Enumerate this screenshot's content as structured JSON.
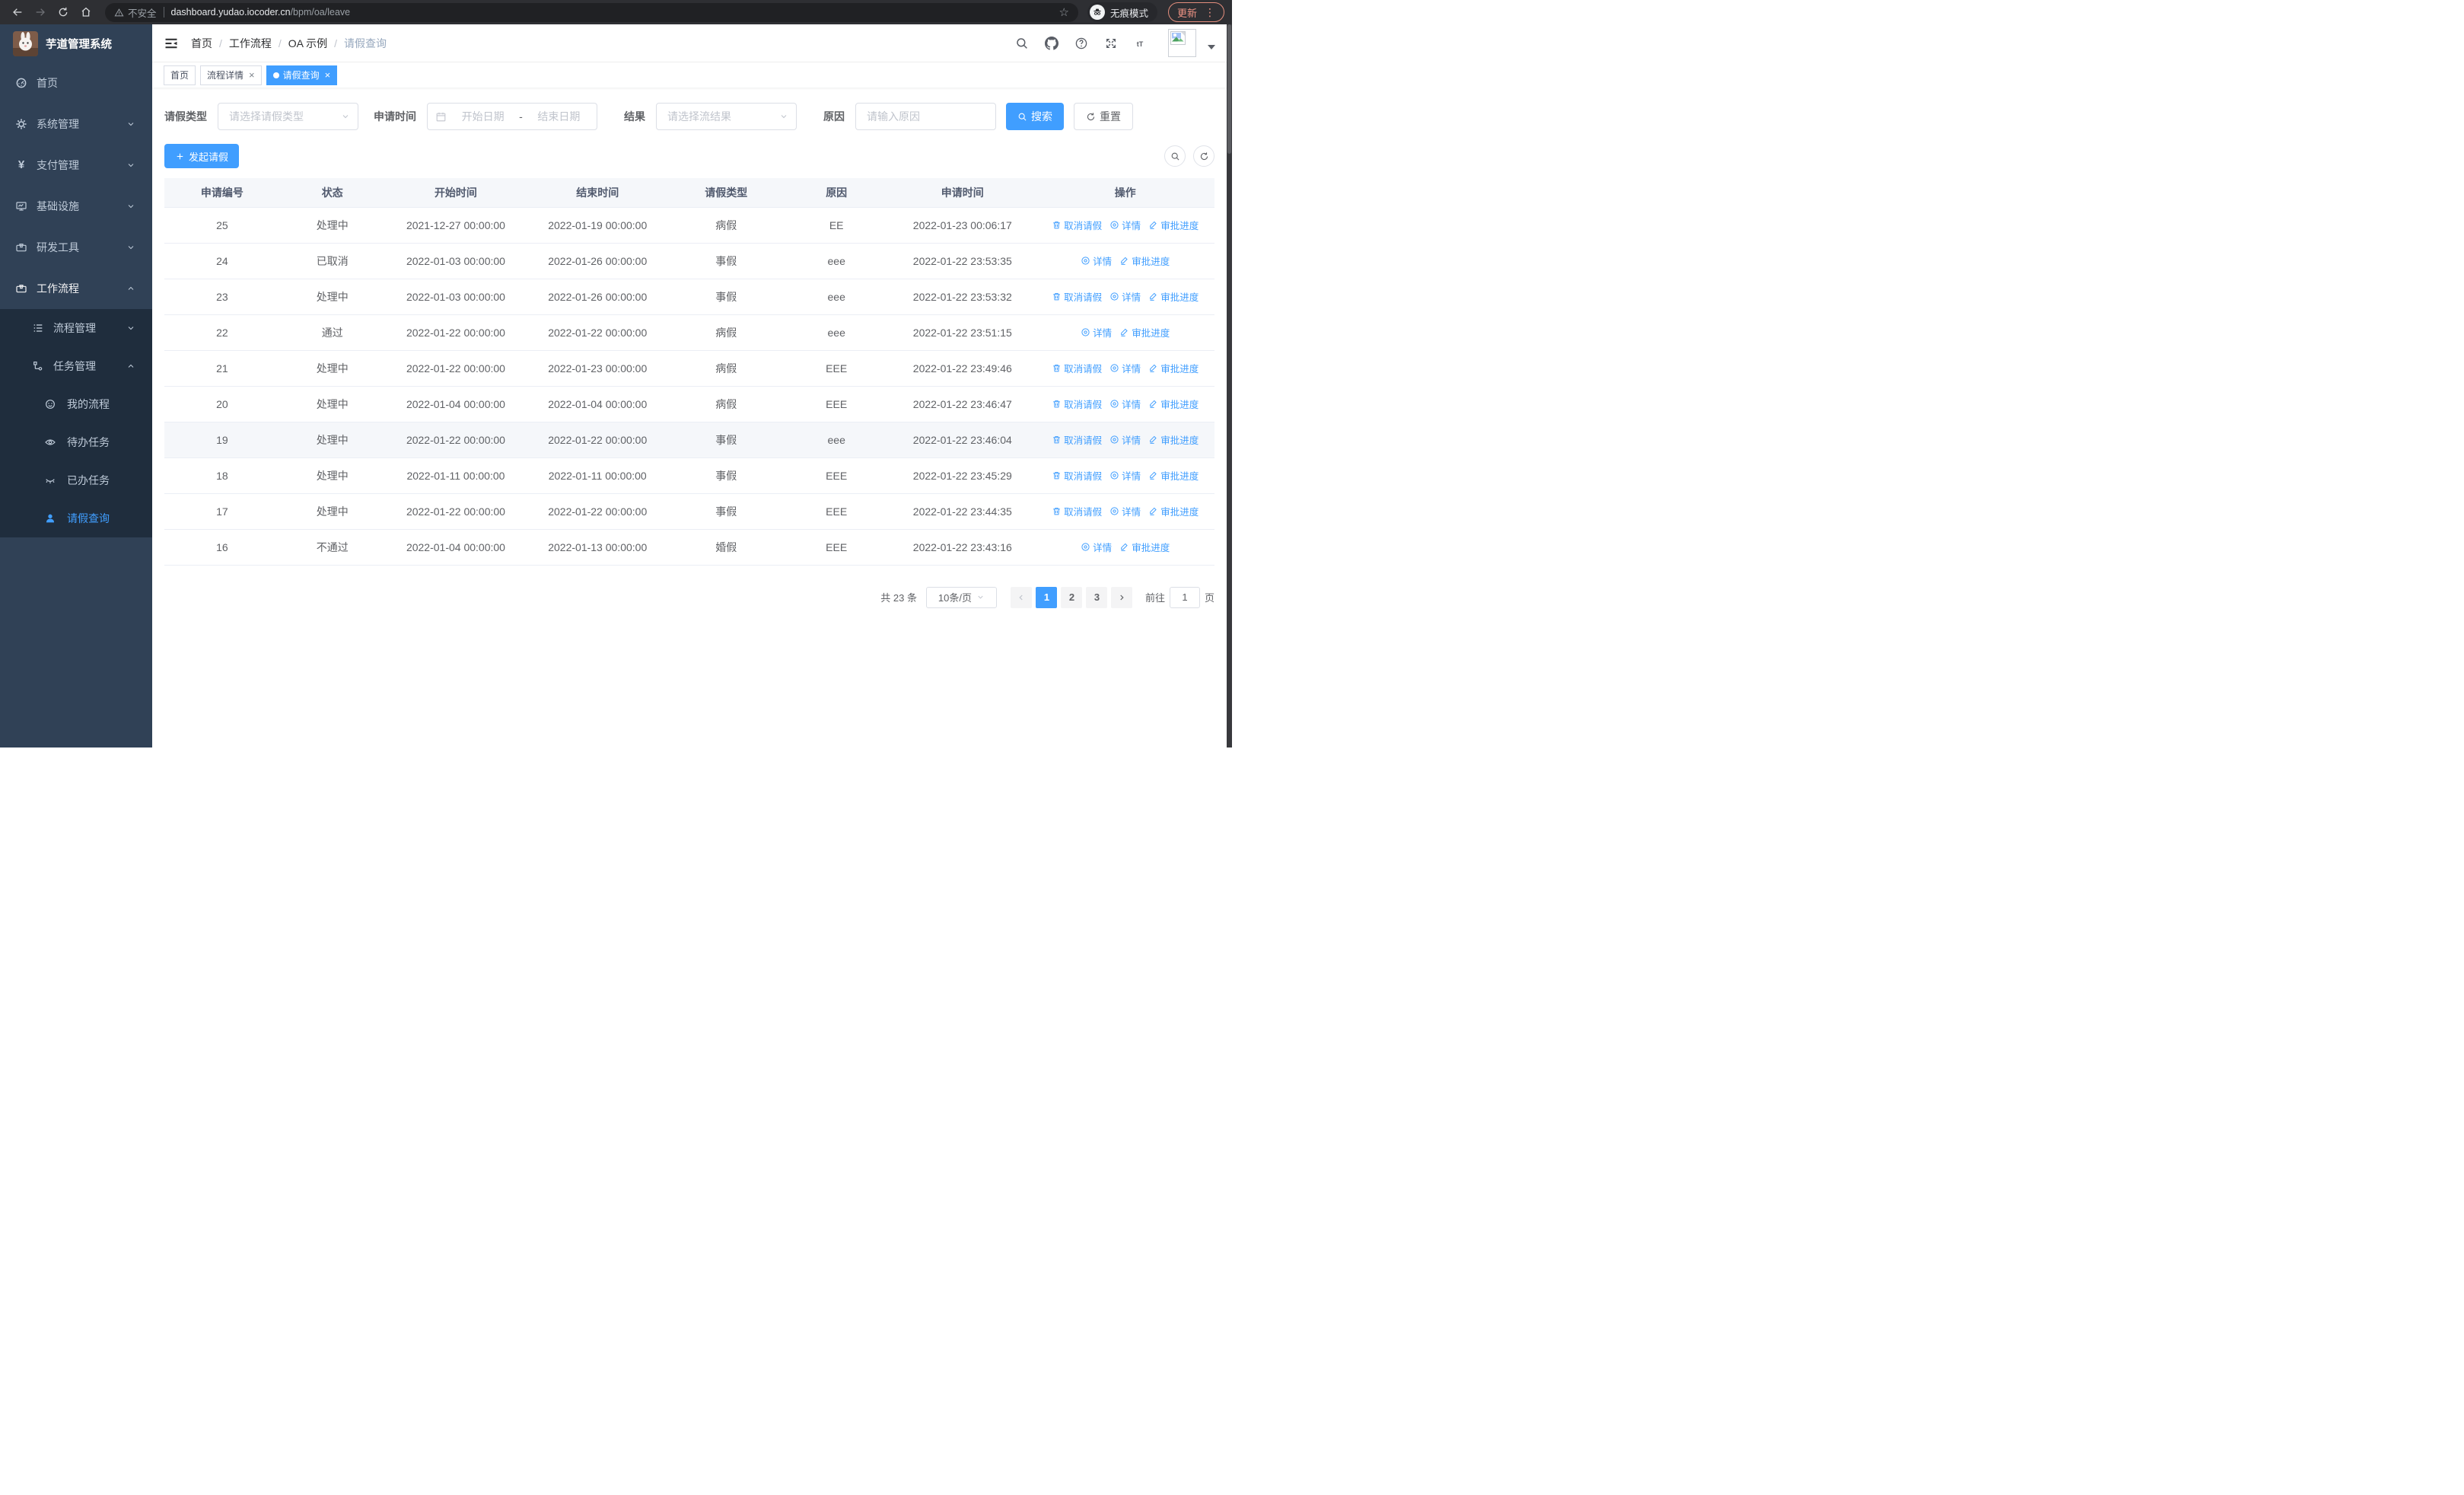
{
  "browser": {
    "security_label": "不安全",
    "url_host": "dashboard.yudao.iocoder.cn",
    "url_path": "/bpm/oa/leave",
    "incognito_label": "无痕模式",
    "update_label": "更新"
  },
  "sidebar": {
    "title": "芋道管理系统",
    "menu": [
      {
        "name": "home",
        "label": "首页",
        "icon": "dashboard-icon",
        "level": 1,
        "submenu": false
      },
      {
        "name": "system-management",
        "label": "系统管理",
        "icon": "gear-icon",
        "level": 1,
        "arrow": "down",
        "submenu": false
      },
      {
        "name": "payment-management",
        "label": "支付管理",
        "icon": "yen-icon",
        "level": 1,
        "arrow": "down",
        "submenu": false
      },
      {
        "name": "infrastructure",
        "label": "基础设施",
        "icon": "monitor-icon",
        "level": 1,
        "arrow": "down",
        "submenu": false
      },
      {
        "name": "dev-tools",
        "label": "研发工具",
        "icon": "toolbox-icon",
        "level": 1,
        "arrow": "down",
        "submenu": false
      },
      {
        "name": "workflow",
        "label": "工作流程",
        "icon": "briefcase-icon",
        "level": 1,
        "arrow": "up",
        "active_parent": true,
        "submenu": false
      },
      {
        "name": "process-management",
        "label": "流程管理",
        "icon": "list-icon",
        "level": 2,
        "arrow": "down",
        "submenu": true
      },
      {
        "name": "task-management",
        "label": "任务管理",
        "icon": "flow-icon",
        "level": 2,
        "arrow": "up",
        "submenu": true
      },
      {
        "name": "my-process",
        "label": "我的流程",
        "icon": "face-icon",
        "level": 3,
        "submenu": true
      },
      {
        "name": "todo-tasks",
        "label": "待办任务",
        "icon": "eye-open-icon",
        "level": 3,
        "submenu": true
      },
      {
        "name": "done-tasks",
        "label": "已办任务",
        "icon": "eye-closed-icon",
        "level": 3,
        "submenu": true
      },
      {
        "name": "leave-query",
        "label": "请假查询",
        "icon": "person-icon",
        "level": 3,
        "active": true,
        "submenu": true
      }
    ]
  },
  "navbar": {
    "breadcrumb": [
      "首页",
      "工作流程",
      "OA 示例",
      "请假查询"
    ]
  },
  "tags": [
    {
      "name": "home",
      "label": "首页",
      "closable": false,
      "active": false
    },
    {
      "name": "process-detail",
      "label": "流程详情",
      "closable": true,
      "active": false
    },
    {
      "name": "leave-query",
      "label": "请假查询",
      "closable": true,
      "active": true
    }
  ],
  "filters": {
    "leave_type_label": "请假类型",
    "leave_type_placeholder": "请选择请假类型",
    "apply_time_label": "申请时间",
    "date_start_placeholder": "开始日期",
    "date_separator": "-",
    "date_end_placeholder": "结束日期",
    "result_label": "结果",
    "result_placeholder": "请选择流结果",
    "reason_label": "原因",
    "reason_placeholder": "请输入原因",
    "search_label": "搜索",
    "reset_label": "重置"
  },
  "toolbar": {
    "create_label": "发起请假"
  },
  "table": {
    "headers": [
      "申请编号",
      "状态",
      "开始时间",
      "结束时间",
      "请假类型",
      "原因",
      "申请时间",
      "操作"
    ],
    "action_labels": {
      "cancel": "取消请假",
      "detail": "详情",
      "progress": "审批进度"
    },
    "rows": [
      {
        "id": "25",
        "status": "处理中",
        "start": "2021-12-27 00:00:00",
        "end": "2022-01-19 00:00:00",
        "type": "病假",
        "reason": "EE",
        "apply_time": "2022-01-23 00:06:17",
        "actions": [
          "cancel",
          "detail",
          "progress"
        ],
        "highlight": false
      },
      {
        "id": "24",
        "status": "已取消",
        "start": "2022-01-03 00:00:00",
        "end": "2022-01-26 00:00:00",
        "type": "事假",
        "reason": "eee",
        "apply_time": "2022-01-22 23:53:35",
        "actions": [
          "detail",
          "progress"
        ],
        "highlight": false
      },
      {
        "id": "23",
        "status": "处理中",
        "start": "2022-01-03 00:00:00",
        "end": "2022-01-26 00:00:00",
        "type": "事假",
        "reason": "eee",
        "apply_time": "2022-01-22 23:53:32",
        "actions": [
          "cancel",
          "detail",
          "progress"
        ],
        "highlight": false
      },
      {
        "id": "22",
        "status": "通过",
        "start": "2022-01-22 00:00:00",
        "end": "2022-01-22 00:00:00",
        "type": "病假",
        "reason": "eee",
        "apply_time": "2022-01-22 23:51:15",
        "actions": [
          "detail",
          "progress"
        ],
        "highlight": false
      },
      {
        "id": "21",
        "status": "处理中",
        "start": "2022-01-22 00:00:00",
        "end": "2022-01-23 00:00:00",
        "type": "病假",
        "reason": "EEE",
        "apply_time": "2022-01-22 23:49:46",
        "actions": [
          "cancel",
          "detail",
          "progress"
        ],
        "highlight": false
      },
      {
        "id": "20",
        "status": "处理中",
        "start": "2022-01-04 00:00:00",
        "end": "2022-01-04 00:00:00",
        "type": "病假",
        "reason": "EEE",
        "apply_time": "2022-01-22 23:46:47",
        "actions": [
          "cancel",
          "detail",
          "progress"
        ],
        "highlight": false
      },
      {
        "id": "19",
        "status": "处理中",
        "start": "2022-01-22 00:00:00",
        "end": "2022-01-22 00:00:00",
        "type": "事假",
        "reason": "eee",
        "apply_time": "2022-01-22 23:46:04",
        "actions": [
          "cancel",
          "detail",
          "progress"
        ],
        "highlight": true
      },
      {
        "id": "18",
        "status": "处理中",
        "start": "2022-01-11 00:00:00",
        "end": "2022-01-11 00:00:00",
        "type": "事假",
        "reason": "EEE",
        "apply_time": "2022-01-22 23:45:29",
        "actions": [
          "cancel",
          "detail",
          "progress"
        ],
        "highlight": false
      },
      {
        "id": "17",
        "status": "处理中",
        "start": "2022-01-22 00:00:00",
        "end": "2022-01-22 00:00:00",
        "type": "事假",
        "reason": "EEE",
        "apply_time": "2022-01-22 23:44:35",
        "actions": [
          "cancel",
          "detail",
          "progress"
        ],
        "highlight": false
      },
      {
        "id": "16",
        "status": "不通过",
        "start": "2022-01-04 00:00:00",
        "end": "2022-01-13 00:00:00",
        "type": "婚假",
        "reason": "EEE",
        "apply_time": "2022-01-22 23:43:16",
        "actions": [
          "detail",
          "progress"
        ],
        "highlight": false
      }
    ]
  },
  "pagination": {
    "total_label": "共 23 条",
    "page_size": "10条/页",
    "pages": [
      "1",
      "2",
      "3"
    ],
    "active_page": "1",
    "goto_label": "前往",
    "goto_value": "1",
    "page_suffix": "页"
  },
  "colors": {
    "accent": "#409eff",
    "sidebar_bg": "#304156",
    "submenu_bg": "#1f2d3d",
    "sidebar_text": "#bfcbd9",
    "table_border": "#ebeef5",
    "table_header_bg": "#f5f7fa",
    "update_button": "#ee9384"
  }
}
